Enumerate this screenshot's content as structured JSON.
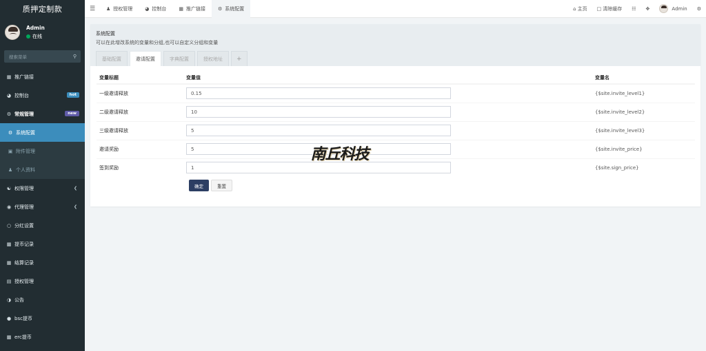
{
  "brand": "质押定制款",
  "user": {
    "name": "Admin",
    "status": "在线"
  },
  "sidebar": {
    "search_placeholder": "搜索菜单",
    "items": [
      {
        "label": "推广链接",
        "icon": "table-icon"
      },
      {
        "label": "控制台",
        "icon": "dashboard-icon",
        "badge": "hot",
        "badge_color": "#3c8dbc"
      },
      {
        "label": "常规管理",
        "icon": "cogs-icon",
        "badge": "new",
        "badge_color": "#605ca8"
      },
      {
        "label": "系统配置",
        "icon": "gear-icon"
      },
      {
        "label": "附件管理",
        "icon": "file-icon"
      },
      {
        "label": "个人资料",
        "icon": "user-icon"
      },
      {
        "label": "权限管理",
        "icon": "group-icon"
      },
      {
        "label": "代理管理",
        "icon": "user-circle-icon"
      },
      {
        "label": "分红设置",
        "icon": "circle-icon"
      },
      {
        "label": "提币记录",
        "icon": "bank-icon"
      },
      {
        "label": "结算记录",
        "icon": "calculator-icon"
      },
      {
        "label": "授权管理",
        "icon": "file-text-icon"
      },
      {
        "label": "公告",
        "icon": "adjust-icon"
      },
      {
        "label": "bsc提币",
        "icon": "car-icon"
      },
      {
        "label": "erc提币",
        "icon": "bank-icon"
      }
    ]
  },
  "topbar": {
    "tabs": [
      {
        "label": "授权管理",
        "icon": "users-icon"
      },
      {
        "label": "控制台",
        "icon": "dashboard-icon"
      },
      {
        "label": "推广链接",
        "icon": "table-icon"
      },
      {
        "label": "系统配置",
        "icon": "gear-icon"
      }
    ],
    "home": "主页",
    "clear_cache": "清除缓存",
    "user": "Admin"
  },
  "panel": {
    "title": "系统配置",
    "description": "可以在此增改系统的变量和分组,也可以自定义分组和变量",
    "tabs": [
      "基础配置",
      "邀请配置",
      "字典配置",
      "授权地址"
    ],
    "columns": [
      "变量标题",
      "变量值",
      "变量名"
    ],
    "rows": [
      {
        "title": "一级邀请释放",
        "value": "0.15",
        "name": "{$site.invite_level1}"
      },
      {
        "title": "二级邀请释放",
        "value": "10",
        "name": "{$site.invite_level2}"
      },
      {
        "title": "三级邀请释放",
        "value": "5",
        "name": "{$site.invite_level3}"
      },
      {
        "title": "邀请奖励",
        "value": "5",
        "name": "{$site.invite_price}"
      },
      {
        "title": "签到奖励",
        "value": "1",
        "name": "{$site.sign_price}"
      }
    ],
    "submit": "确定",
    "reset": "重置"
  },
  "watermark": "南丘科技"
}
